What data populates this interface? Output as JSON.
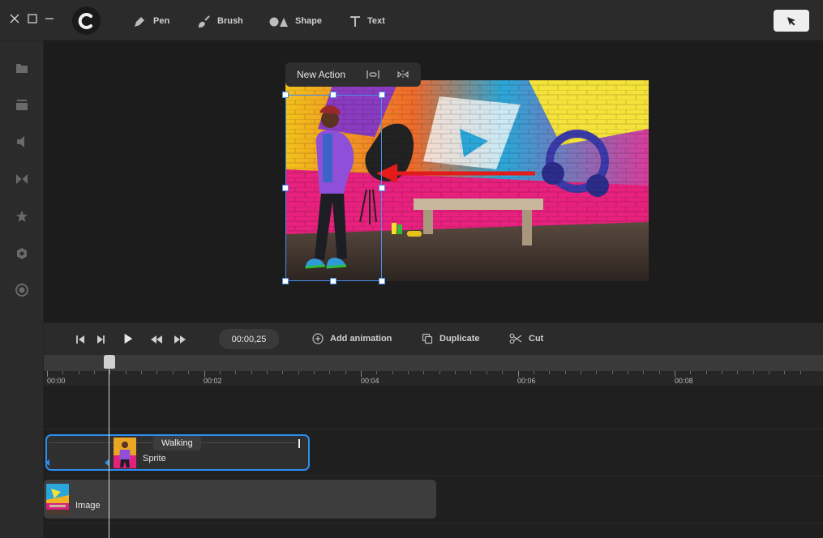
{
  "toolbar": {
    "pen_label": "Pen",
    "brush_label": "Brush",
    "shape_label": "Shape",
    "text_label": "Text",
    "select_icon": "cursor-icon"
  },
  "sidebar": {
    "icons": [
      "folder-icon",
      "media-icon",
      "audio-icon",
      "transition-icon",
      "star-icon",
      "hexagon-icon",
      "record-icon"
    ]
  },
  "canvas": {
    "popup_label": "New Action"
  },
  "transport": {
    "time": "00:00,25",
    "add_animation_label": "Add animation",
    "duplicate_label": "Duplicate",
    "cut_label": "Cut"
  },
  "ruler": {
    "labels": [
      "00:00",
      "00:02",
      "00:04",
      "00:06",
      "00:08"
    ]
  },
  "tracks": {
    "sprite_label": "Sprite",
    "sprite_animation_badge": "Walking",
    "image_label": "Image"
  },
  "colors": {
    "accent": "#2d8ef0",
    "arrow": "#e31b1b"
  }
}
